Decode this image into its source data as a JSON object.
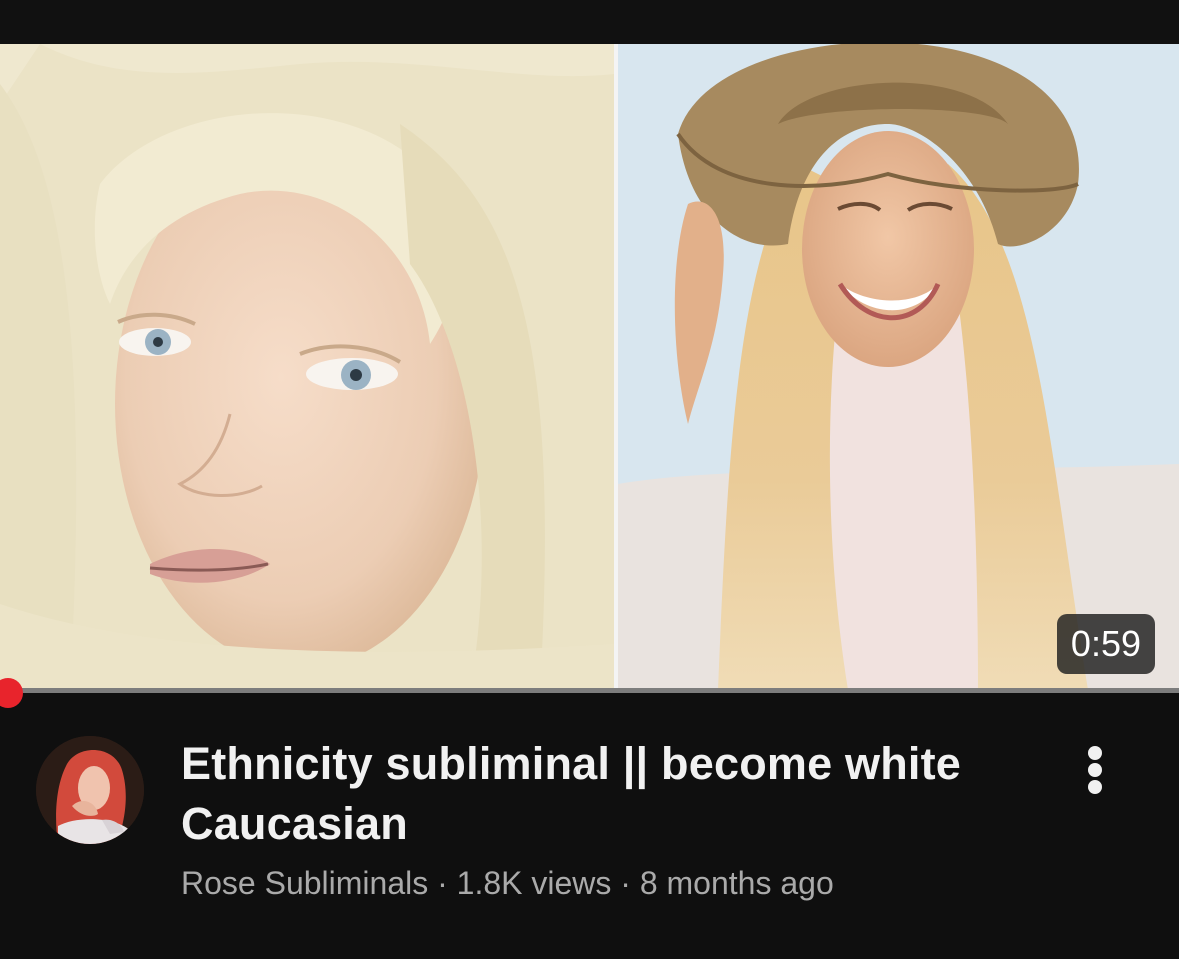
{
  "video": {
    "duration": "0:59",
    "progress_fraction": 0.01,
    "title": "Ethnicity subliminal || become white Caucasian",
    "channel": "Rose Subliminals",
    "separator": " · ",
    "views": "1.8K views",
    "age": "8 months ago"
  },
  "icons": {
    "more": "more-vertical-icon"
  },
  "colors": {
    "background": "#0f0f0f",
    "title_text": "#f1f1f1",
    "meta_text": "#aaaaaa",
    "progress_played": "#ff0000",
    "progress_dot": "#e8242c",
    "progress_track": "#7d7d7d"
  }
}
